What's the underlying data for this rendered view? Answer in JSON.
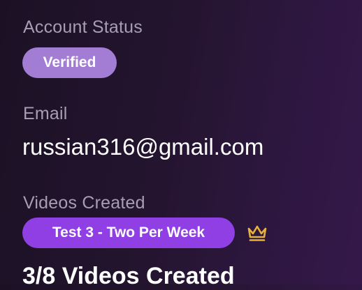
{
  "account_status": {
    "label": "Account Status",
    "badge": "Verified"
  },
  "email": {
    "label": "Email",
    "value": "russian316@gmail.com"
  },
  "videos": {
    "label": "Videos Created",
    "plan_badge": "Test 3 - Two Per Week",
    "plan_icon": "crown-icon",
    "count_text": "3/8 Videos Created"
  },
  "colors": {
    "verified_badge": "#a37cd4",
    "plan_badge": "#8f3fe3",
    "crown": "#e6b23c",
    "label_text": "#a79eb3"
  }
}
